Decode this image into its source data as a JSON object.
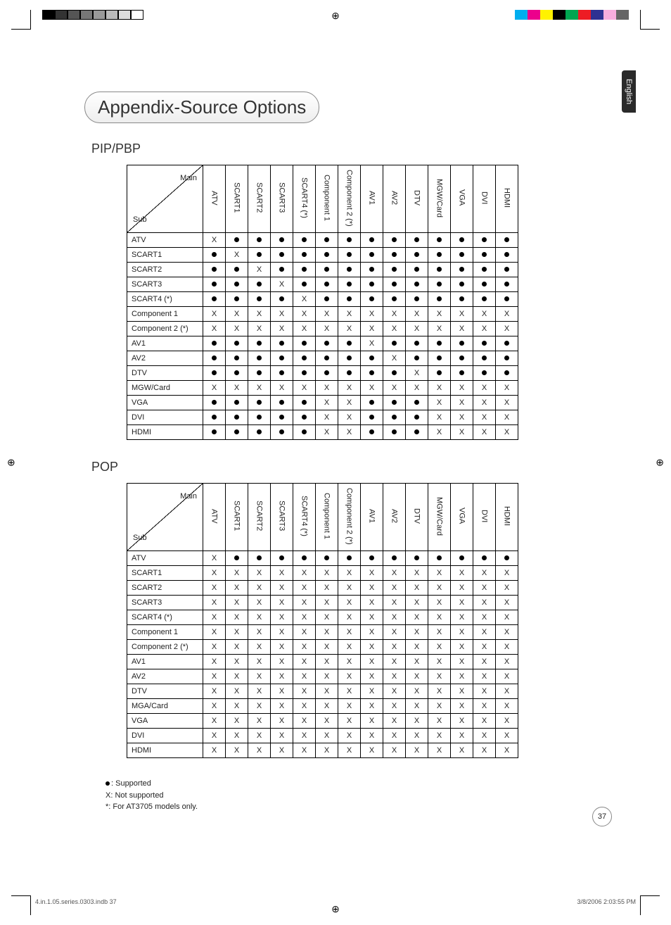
{
  "lang_tab": "English",
  "title": "Appendix-Source Options",
  "section1": "PIP/PBP",
  "section2": "POP",
  "corner_main": "Main",
  "corner_sub": "Sub",
  "columns": [
    "ATV",
    "SCART1",
    "SCART2",
    "SCART3",
    "SCART4 (*)",
    "Component 1",
    "Component 2 (*)",
    "AV1",
    "AV2",
    "DTV",
    "MGW/Card",
    "VGA",
    "DVI",
    "HDMI"
  ],
  "rows_pip": [
    "ATV",
    "SCART1",
    "SCART2",
    "SCART3",
    "SCART4 (*)",
    "Component 1",
    "Component 2 (*)",
    "AV1",
    "AV2",
    "DTV",
    "MGW/Card",
    "VGA",
    "DVI",
    "HDMI"
  ],
  "rows_pop": [
    "ATV",
    "SCART1",
    "SCART2",
    "SCART3",
    "SCART4 (*)",
    "Component 1",
    "Component 2 (*)",
    "AV1",
    "AV2",
    "DTV",
    "MGA/Card",
    "VGA",
    "DVI",
    "HDMI"
  ],
  "chart_data": [
    {
      "type": "table",
      "title": "PIP/PBP",
      "columns": [
        "ATV",
        "SCART1",
        "SCART2",
        "SCART3",
        "SCART4 (*)",
        "Component 1",
        "Component 2 (*)",
        "AV1",
        "AV2",
        "DTV",
        "MGW/Card",
        "VGA",
        "DVI",
        "HDMI"
      ],
      "rows": [
        "ATV",
        "SCART1",
        "SCART2",
        "SCART3",
        "SCART4 (*)",
        "Component 1",
        "Component 2 (*)",
        "AV1",
        "AV2",
        "DTV",
        "MGW/Card",
        "VGA",
        "DVI",
        "HDMI"
      ],
      "values": [
        [
          "X",
          "●",
          "●",
          "●",
          "●",
          "●",
          "●",
          "●",
          "●",
          "●",
          "●",
          "●",
          "●",
          "●"
        ],
        [
          "●",
          "X",
          "●",
          "●",
          "●",
          "●",
          "●",
          "●",
          "●",
          "●",
          "●",
          "●",
          "●",
          "●"
        ],
        [
          "●",
          "●",
          "X",
          "●",
          "●",
          "●",
          "●",
          "●",
          "●",
          "●",
          "●",
          "●",
          "●",
          "●"
        ],
        [
          "●",
          "●",
          "●",
          "X",
          "●",
          "●",
          "●",
          "●",
          "●",
          "●",
          "●",
          "●",
          "●",
          "●"
        ],
        [
          "●",
          "●",
          "●",
          "●",
          "X",
          "●",
          "●",
          "●",
          "●",
          "●",
          "●",
          "●",
          "●",
          "●"
        ],
        [
          "X",
          "X",
          "X",
          "X",
          "X",
          "X",
          "X",
          "X",
          "X",
          "X",
          "X",
          "X",
          "X",
          "X"
        ],
        [
          "X",
          "X",
          "X",
          "X",
          "X",
          "X",
          "X",
          "X",
          "X",
          "X",
          "X",
          "X",
          "X",
          "X"
        ],
        [
          "●",
          "●",
          "●",
          "●",
          "●",
          "●",
          "●",
          "X",
          "●",
          "●",
          "●",
          "●",
          "●",
          "●"
        ],
        [
          "●",
          "●",
          "●",
          "●",
          "●",
          "●",
          "●",
          "●",
          "X",
          "●",
          "●",
          "●",
          "●",
          "●"
        ],
        [
          "●",
          "●",
          "●",
          "●",
          "●",
          "●",
          "●",
          "●",
          "●",
          "X",
          "●",
          "●",
          "●",
          "●"
        ],
        [
          "X",
          "X",
          "X",
          "X",
          "X",
          "X",
          "X",
          "X",
          "X",
          "X",
          "X",
          "X",
          "X",
          "X"
        ],
        [
          "●",
          "●",
          "●",
          "●",
          "●",
          "X",
          "X",
          "●",
          "●",
          "●",
          "X",
          "X",
          "X",
          "X"
        ],
        [
          "●",
          "●",
          "●",
          "●",
          "●",
          "X",
          "X",
          "●",
          "●",
          "●",
          "X",
          "X",
          "X",
          "X"
        ],
        [
          "●",
          "●",
          "●",
          "●",
          "●",
          "X",
          "X",
          "●",
          "●",
          "●",
          "X",
          "X",
          "X",
          "X"
        ]
      ]
    },
    {
      "type": "table",
      "title": "POP",
      "columns": [
        "ATV",
        "SCART1",
        "SCART2",
        "SCART3",
        "SCART4 (*)",
        "Component 1",
        "Component 2 (*)",
        "AV1",
        "AV2",
        "DTV",
        "MGW/Card",
        "VGA",
        "DVI",
        "HDMI"
      ],
      "rows": [
        "ATV",
        "SCART1",
        "SCART2",
        "SCART3",
        "SCART4 (*)",
        "Component 1",
        "Component 2 (*)",
        "AV1",
        "AV2",
        "DTV",
        "MGA/Card",
        "VGA",
        "DVI",
        "HDMI"
      ],
      "values": [
        [
          "X",
          "●",
          "●",
          "●",
          "●",
          "●",
          "●",
          "●",
          "●",
          "●",
          "●",
          "●",
          "●",
          "●"
        ],
        [
          "X",
          "X",
          "X",
          "X",
          "X",
          "X",
          "X",
          "X",
          "X",
          "X",
          "X",
          "X",
          "X",
          "X"
        ],
        [
          "X",
          "X",
          "X",
          "X",
          "X",
          "X",
          "X",
          "X",
          "X",
          "X",
          "X",
          "X",
          "X",
          "X"
        ],
        [
          "X",
          "X",
          "X",
          "X",
          "X",
          "X",
          "X",
          "X",
          "X",
          "X",
          "X",
          "X",
          "X",
          "X"
        ],
        [
          "X",
          "X",
          "X",
          "X",
          "X",
          "X",
          "X",
          "X",
          "X",
          "X",
          "X",
          "X",
          "X",
          "X"
        ],
        [
          "X",
          "X",
          "X",
          "X",
          "X",
          "X",
          "X",
          "X",
          "X",
          "X",
          "X",
          "X",
          "X",
          "X"
        ],
        [
          "X",
          "X",
          "X",
          "X",
          "X",
          "X",
          "X",
          "X",
          "X",
          "X",
          "X",
          "X",
          "X",
          "X"
        ],
        [
          "X",
          "X",
          "X",
          "X",
          "X",
          "X",
          "X",
          "X",
          "X",
          "X",
          "X",
          "X",
          "X",
          "X"
        ],
        [
          "X",
          "X",
          "X",
          "X",
          "X",
          "X",
          "X",
          "X",
          "X",
          "X",
          "X",
          "X",
          "X",
          "X"
        ],
        [
          "X",
          "X",
          "X",
          "X",
          "X",
          "X",
          "X",
          "X",
          "X",
          "X",
          "X",
          "X",
          "X",
          "X"
        ],
        [
          "X",
          "X",
          "X",
          "X",
          "X",
          "X",
          "X",
          "X",
          "X",
          "X",
          "X",
          "X",
          "X",
          "X"
        ],
        [
          "X",
          "X",
          "X",
          "X",
          "X",
          "X",
          "X",
          "X",
          "X",
          "X",
          "X",
          "X",
          "X",
          "X"
        ],
        [
          "X",
          "X",
          "X",
          "X",
          "X",
          "X",
          "X",
          "X",
          "X",
          "X",
          "X",
          "X",
          "X",
          "X"
        ],
        [
          "X",
          "X",
          "X",
          "X",
          "X",
          "X",
          "X",
          "X",
          "X",
          "X",
          "X",
          "X",
          "X",
          "X"
        ]
      ]
    }
  ],
  "legend": {
    "supported": ": Supported",
    "not_supported": "X: Not supported",
    "note": "*: For AT3705 models only."
  },
  "page_number": "37",
  "footer_left": "4.in.1.05.series.0303.indb   37",
  "footer_right": "3/8/2006   2:03:55 PM",
  "colorbar_left": [
    "#000",
    "#333",
    "#555",
    "#777",
    "#999",
    "#bbb",
    "#ddd",
    "#fff"
  ],
  "colorbar_right": [
    "#00aeef",
    "#ec008c",
    "#fff200",
    "#000",
    "#00a651",
    "#ed1c24",
    "#2e3192",
    "#f7adde",
    "#666"
  ]
}
